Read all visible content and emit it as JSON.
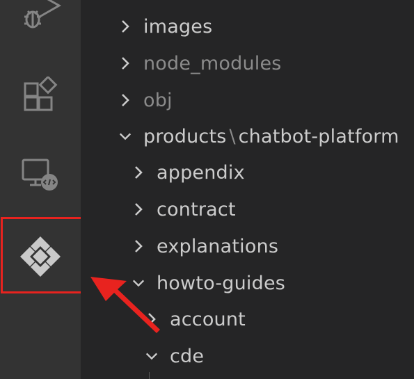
{
  "activity_bar": {
    "icons": [
      "run-debug-icon",
      "extensions-icon",
      "remote-explorer-icon",
      "puzzle-diamond-icon"
    ],
    "highlight_color": "#e8231f"
  },
  "explorer": {
    "items": [
      {
        "label": "images",
        "state": "collapsed",
        "dimmed": false
      },
      {
        "label": "node_modules",
        "state": "collapsed",
        "dimmed": true
      },
      {
        "label": "obj",
        "state": "collapsed",
        "dimmed": true
      },
      {
        "label": "products",
        "separator": "\\",
        "label_extra": "chatbot-platform",
        "state": "expanded",
        "dimmed": false
      },
      {
        "label": "appendix",
        "state": "collapsed",
        "dimmed": false
      },
      {
        "label": "contract",
        "state": "collapsed",
        "dimmed": false
      },
      {
        "label": "explanations",
        "state": "collapsed",
        "dimmed": false
      },
      {
        "label": "howto-guides",
        "state": "expanded",
        "dimmed": false
      },
      {
        "label": "account",
        "state": "collapsed",
        "dimmed": false
      },
      {
        "label": "cde",
        "state": "expanded",
        "dimmed": false
      }
    ]
  },
  "colors": {
    "activity_bar_bg": "#333333",
    "sidebar_bg": "#252526",
    "text": "#cccccc",
    "text_dim": "#8b8b8b",
    "annotation": "#e8231f"
  }
}
